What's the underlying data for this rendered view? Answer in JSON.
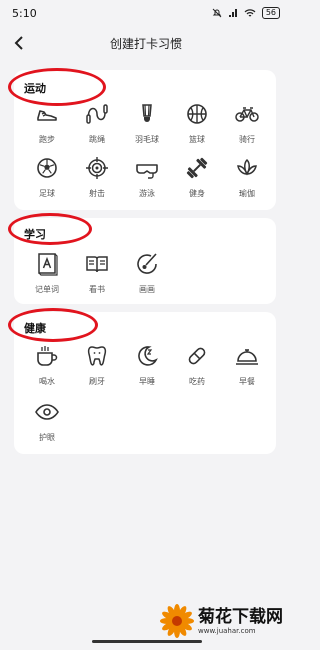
{
  "status": {
    "time": "5:10",
    "battery": "56"
  },
  "header": {
    "title": "创建打卡习惯"
  },
  "sections": [
    {
      "title": "运动",
      "items": [
        {
          "label": "跑步",
          "icon": "shoe-icon"
        },
        {
          "label": "跳绳",
          "icon": "jump-rope-icon"
        },
        {
          "label": "羽毛球",
          "icon": "shuttlecock-icon"
        },
        {
          "label": "篮球",
          "icon": "basketball-icon"
        },
        {
          "label": "骑行",
          "icon": "bicycle-icon"
        },
        {
          "label": "足球",
          "icon": "soccer-ball-icon"
        },
        {
          "label": "射击",
          "icon": "target-icon"
        },
        {
          "label": "游泳",
          "icon": "goggles-icon"
        },
        {
          "label": "健身",
          "icon": "dumbbell-icon"
        },
        {
          "label": "瑜伽",
          "icon": "lotus-icon"
        }
      ]
    },
    {
      "title": "学习",
      "items": [
        {
          "label": "记单词",
          "icon": "letter-card-icon"
        },
        {
          "label": "看书",
          "icon": "open-book-icon"
        },
        {
          "label": "画画",
          "icon": "palette-icon"
        }
      ]
    },
    {
      "title": "健康",
      "items": [
        {
          "label": "喝水",
          "icon": "cup-icon"
        },
        {
          "label": "刷牙",
          "icon": "tooth-icon"
        },
        {
          "label": "早睡",
          "icon": "moon-icon"
        },
        {
          "label": "吃药",
          "icon": "pill-icon"
        },
        {
          "label": "早餐",
          "icon": "food-cloche-icon"
        },
        {
          "label": "护眼",
          "icon": "eye-icon"
        }
      ]
    }
  ],
  "watermark": {
    "title": "菊花下载网",
    "url": "www.juahar.com"
  },
  "colors": {
    "highlight": "#e1141e",
    "icon": "#333333",
    "background": "#f3f3f5"
  }
}
